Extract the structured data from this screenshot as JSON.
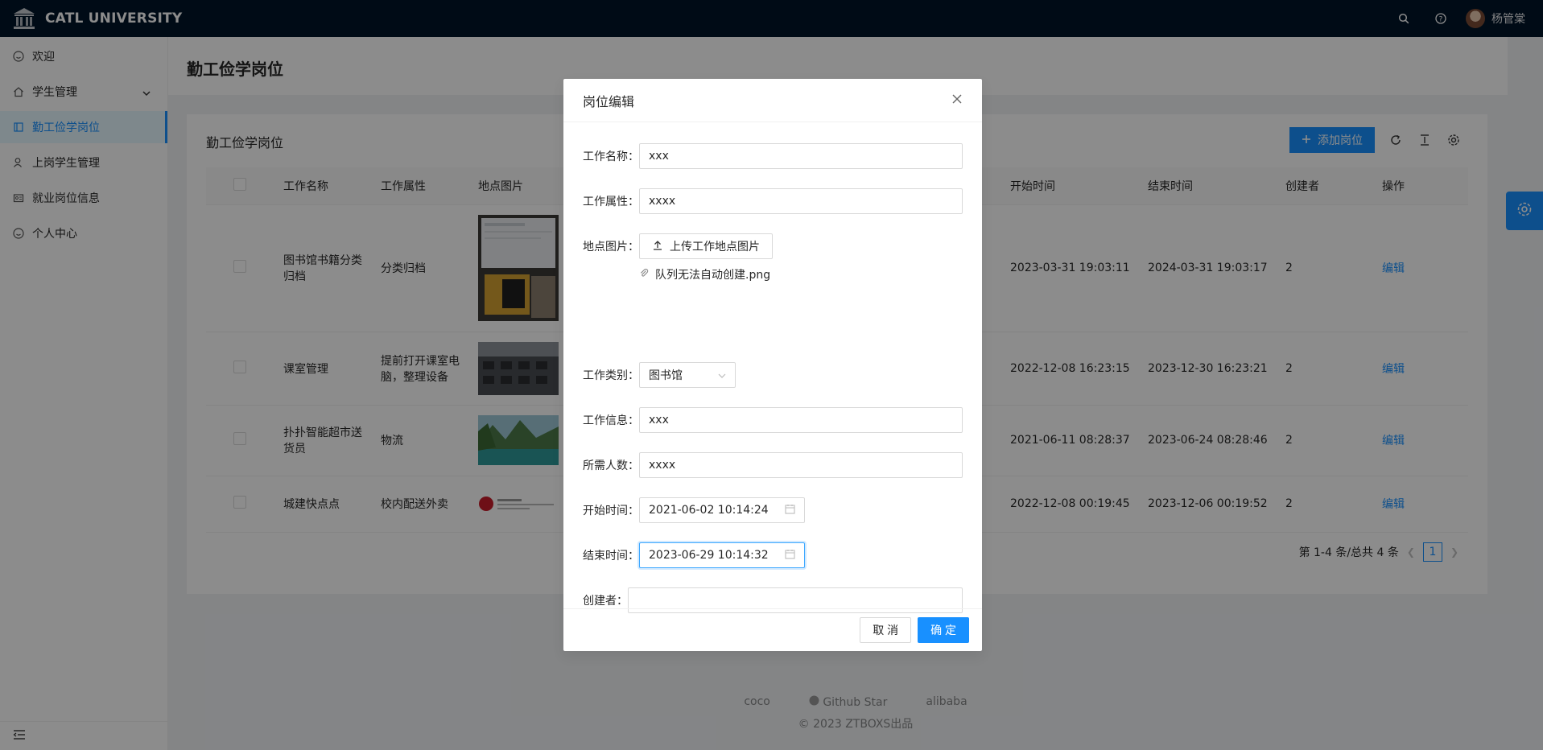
{
  "app": {
    "title": "CATL UNIVERSITY",
    "user": "杨管棠"
  },
  "sidebar": {
    "items": [
      {
        "label": "欢迎",
        "icon": "smile-icon"
      },
      {
        "label": "学生管理",
        "icon": "home-icon"
      },
      {
        "label": "勤工俭学岗位",
        "icon": "book-icon"
      },
      {
        "label": "上岗学生管理",
        "icon": "user-icon"
      },
      {
        "label": "就业岗位信息",
        "icon": "idcard-icon"
      },
      {
        "label": "个人中心",
        "icon": "smile-icon"
      }
    ]
  },
  "page": {
    "title": "勤工俭学岗位"
  },
  "card": {
    "title": "勤工俭学岗位",
    "add_button": "添加岗位"
  },
  "table": {
    "headers": [
      "工作名称",
      "工作属性",
      "地点图片",
      "开始时间",
      "结束时间",
      "创建者",
      "操作"
    ],
    "rows": [
      {
        "name": "图书馆书籍分类归档",
        "attr": "分类归档",
        "start": "2023-03-31 19:03:11",
        "end": "2024-03-31 19:03:17",
        "creator": "2",
        "action": "编辑"
      },
      {
        "name": "课室管理",
        "attr": "提前打开课室电脑，整理设备",
        "start": "2022-12-08 16:23:15",
        "end": "2023-12-30 16:23:21",
        "creator": "2",
        "action": "编辑"
      },
      {
        "name": "扑扑智能超市送货员",
        "attr": "物流",
        "start": "2021-06-11 08:28:37",
        "end": "2023-06-24 08:28:46",
        "creator": "2",
        "action": "编辑"
      },
      {
        "name": "城建快点点",
        "attr": "校内配送外卖",
        "start": "2022-12-08 00:19:45",
        "end": "2023-12-06 00:19:52",
        "creator": "2",
        "action": "编辑"
      }
    ]
  },
  "pagination": {
    "summary": "第 1-4 条/总共 4 条",
    "current": "1"
  },
  "footer": {
    "links": [
      "coco",
      "Github Star",
      "alibaba"
    ],
    "copyright": "2023 ZTBOXS出品"
  },
  "modal": {
    "title": "岗位编辑",
    "fields": {
      "name": {
        "label": "工作名称：",
        "value": "xxx"
      },
      "attr": {
        "label": "工作属性：",
        "value": "xxxx"
      },
      "image": {
        "label": "地点图片：",
        "button": "上传工作地点图片",
        "file": "队列无法自动创建.png"
      },
      "category": {
        "label": "工作类别：",
        "value": "图书馆"
      },
      "info": {
        "label": "工作信息：",
        "value": "xxx"
      },
      "count": {
        "label": "所需人数：",
        "value": "xxxx"
      },
      "start": {
        "label": "开始时间：",
        "value": "2021-06-02 10:14:24"
      },
      "end": {
        "label": "结束时间：",
        "value": "2023-06-29 10:14:32"
      },
      "creator": {
        "label": "创建者：",
        "value": ""
      }
    },
    "cancel": "取 消",
    "ok": "确 定"
  },
  "colors": {
    "header_bg": "#001529",
    "primary": "#1890ff"
  }
}
